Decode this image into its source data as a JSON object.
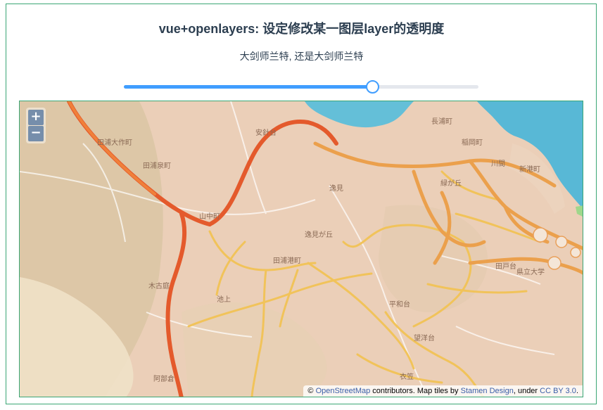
{
  "page": {
    "title": "vue+openlayers: 设定修改某一图层layer的透明度",
    "subtitle": "大剑师兰特, 还是大剑师兰特"
  },
  "slider": {
    "value_percent": 70,
    "accent_color": "#409eff"
  },
  "map": {
    "zoom_in_label": "+",
    "zoom_out_label": "−",
    "attribution": {
      "prefix": "©",
      "osm_link": "OpenStreetMap",
      "mid": "contributors. Map tiles by",
      "stamen_link": "Stamen Design",
      "under": ", under",
      "license_link": "CC BY 3.0",
      "suffix": "."
    },
    "place_labels": {
      "l1": "田浦大作町",
      "l2": "田浦泉町",
      "l3": "安針台",
      "l4": "長浦町",
      "l5": "稲岡町",
      "l6": "新港町",
      "l7": "逸見",
      "l8": "緑が丘",
      "l9": "山中町",
      "l10": "逸見が丘",
      "l11": "田戸台",
      "l12": "県立大学",
      "l13": "木古庭",
      "l14": "池上",
      "l15": "望洋台",
      "l16": "衣笠",
      "l17": "阿部倉",
      "l18": "平和台",
      "l19": "田浦港町",
      "l20": "川間"
    }
  }
}
